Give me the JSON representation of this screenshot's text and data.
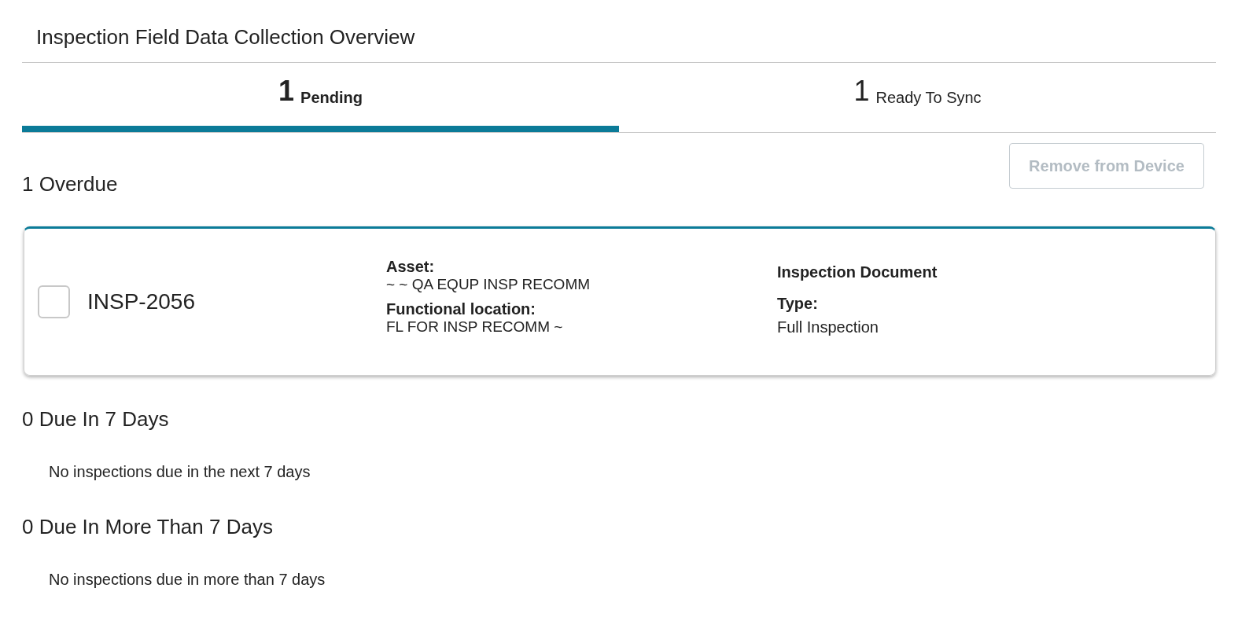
{
  "title": "Inspection Field Data Collection Overview",
  "tabs": [
    {
      "count": "1",
      "label": "Pending",
      "selected": true
    },
    {
      "count": "1",
      "label": "Ready To Sync",
      "selected": false
    }
  ],
  "remove_button": {
    "label": "Remove from Device",
    "disabled": true
  },
  "sections": [
    {
      "heading": "1 Overdue",
      "cards": [
        {
          "id": "INSP-2056",
          "checked": false,
          "middle": [
            {
              "label": "Asset:",
              "value": "~ ~ QA EQUP INSP RECOMM"
            },
            {
              "label": "Functional location:",
              "value": "FL FOR INSP RECOMM ~"
            }
          ],
          "right": {
            "title": "Inspection Document",
            "label": "Type:",
            "value": "Full Inspection"
          }
        }
      ]
    },
    {
      "heading": "0 Due In 7 Days",
      "empty_text": "No inspections due in the next 7 days"
    },
    {
      "heading": "0 Due In More Than 7 Days",
      "empty_text": "No inspections due in more than 7 days"
    }
  ]
}
